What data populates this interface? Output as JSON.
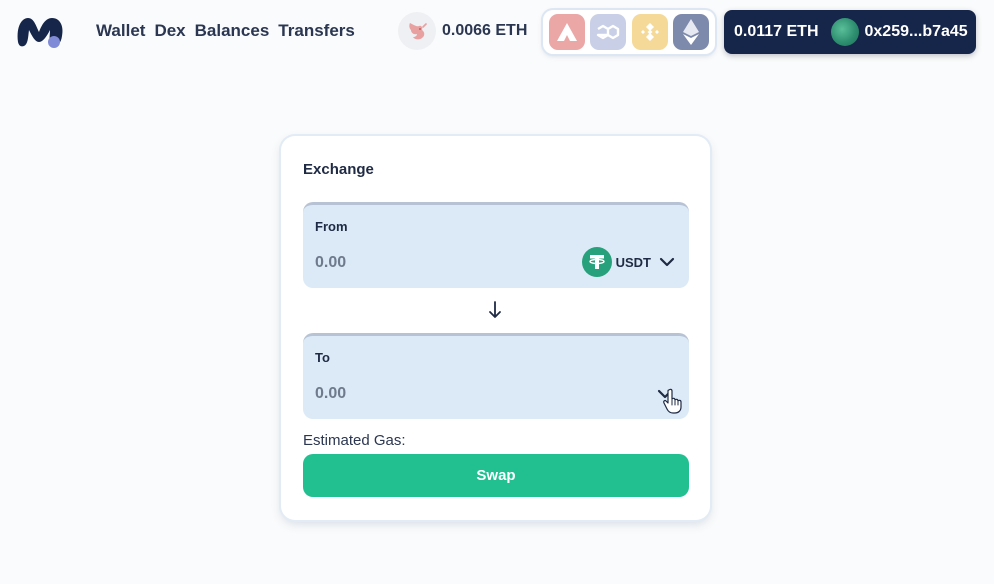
{
  "header": {
    "nav": [
      "Wallet",
      "Dex",
      "Balances",
      "Transfers"
    ],
    "uni_balance": "0.0066 ETH",
    "chains": [
      "avalanche-icon",
      "polygon-icon",
      "bnb-icon",
      "ethereum-icon"
    ],
    "account": {
      "balance": "0.0117 ETH",
      "address": "0x259...b7a45"
    }
  },
  "exchange": {
    "title": "Exchange",
    "from": {
      "label": "From",
      "placeholder": "0.00",
      "token": "USDT"
    },
    "to": {
      "label": "To",
      "placeholder": "0.00"
    },
    "gas_label": "Estimated Gas:",
    "swap_label": "Swap"
  },
  "colors": {
    "accent": "#22bf91",
    "account_bg": "#16254a",
    "box_bg": "#dbeaf6",
    "usdt": "#26a17b"
  }
}
